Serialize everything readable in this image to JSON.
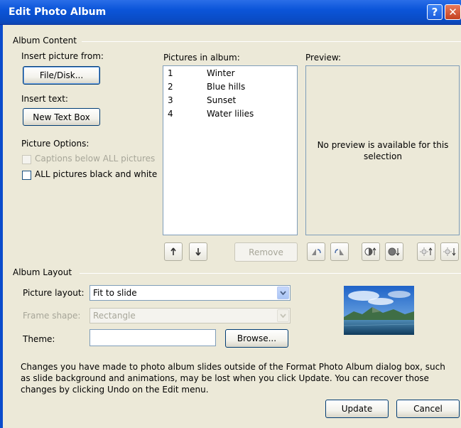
{
  "window": {
    "title": "Edit Photo Album",
    "help_glyph": "?",
    "close_glyph": "✕"
  },
  "album_content": {
    "group_label": "Album Content",
    "insert_picture_label": "Insert picture from:",
    "file_disk_button": "File/Disk...",
    "insert_text_label": "Insert text:",
    "new_text_box_button": "New Text Box",
    "picture_options_label": "Picture Options:",
    "captions_checkbox_label": "Captions below ALL pictures",
    "captions_checked": false,
    "captions_enabled": false,
    "black_white_checkbox_label": "ALL pictures black and white",
    "black_white_checked": false
  },
  "pictures": {
    "label": "Pictures in album:",
    "items": [
      {
        "num": "1",
        "name": "Winter"
      },
      {
        "num": "2",
        "name": "Blue hills"
      },
      {
        "num": "3",
        "name": "Sunset"
      },
      {
        "num": "4",
        "name": "Water lilies"
      }
    ],
    "move_up_icon": "arrow-up-icon",
    "move_down_icon": "arrow-down-icon",
    "remove_button": "Remove"
  },
  "preview": {
    "label": "Preview:",
    "message": "No preview is available for this selection",
    "tool_icons": [
      "rotate-left-icon",
      "rotate-right-icon",
      "contrast-up-icon",
      "contrast-down-icon",
      "brightness-up-icon",
      "brightness-down-icon"
    ]
  },
  "album_layout": {
    "group_label": "Album Layout",
    "picture_layout_label": "Picture layout:",
    "picture_layout_value": "Fit to slide",
    "frame_shape_label": "Frame shape:",
    "frame_shape_value": "Rectangle",
    "theme_label": "Theme:",
    "theme_value": "",
    "browse_button": "Browse..."
  },
  "footer": {
    "notice": "Changes you have made to photo album slides outside of the Format Photo Album dialog box, such as slide background and animations, may be lost when you click Update. You can recover those changes by clicking Undo on the Edit menu.",
    "update_button": "Update",
    "cancel_button": "Cancel"
  },
  "colors": {
    "titlebar": "#0a55d9",
    "dialog_bg": "#ece9d8",
    "list_border": "#7f9db9"
  }
}
